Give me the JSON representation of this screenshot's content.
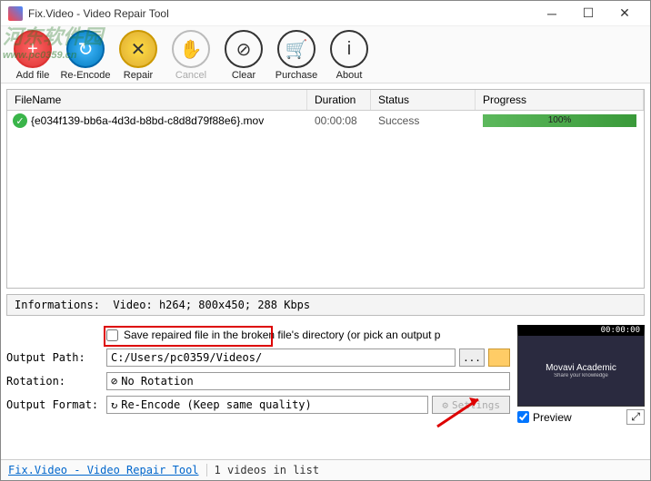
{
  "window": {
    "title": "Fix.Video - Video Repair Tool"
  },
  "toolbar": {
    "add": "Add file",
    "reenc": "Re-Encode",
    "repair": "Repair",
    "cancel": "Cancel",
    "clear": "Clear",
    "purchase": "Purchase",
    "about": "About"
  },
  "table": {
    "headers": {
      "filename": "FileName",
      "duration": "Duration",
      "status": "Status",
      "progress": "Progress"
    },
    "rows": [
      {
        "filename": "{e034f139-bb6a-4d3d-b8bd-c8d8d79f88e6}.mov",
        "duration": "00:00:08",
        "status": "Success",
        "progress": "100%"
      }
    ]
  },
  "info": {
    "label": "Informations:",
    "value": "Video: h264; 800x450; 288 Kbps"
  },
  "options": {
    "save_chk": "Save repaired file in the broken file's directory (or pick an output p",
    "output_path_label": "Output Path:",
    "output_path_value": "C:/Users/pc0359/Videos/",
    "rotation_label": "Rotation:",
    "rotation_value": "No Rotation",
    "format_label": "Output Format:",
    "format_value": "Re-Encode (Keep same quality)",
    "browse": "...",
    "settings": "Settings"
  },
  "preview": {
    "timestamp": "00:00:00",
    "text1": "Movavi Academic",
    "text2": "Share your knowledge",
    "label": "Preview"
  },
  "status": {
    "link": "Fix.Video - Video Repair Tool",
    "count": "1 videos in list"
  },
  "watermark": {
    "main": "河东软件园",
    "url": "www.pc0359.cn"
  }
}
